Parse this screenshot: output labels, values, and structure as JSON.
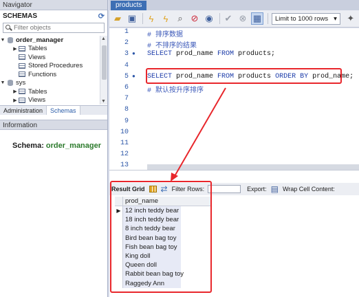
{
  "navigator": {
    "title": "Navigator",
    "schemas_label": "SCHEMAS",
    "filter_placeholder": "Filter objects",
    "tree": [
      {
        "label": "order_manager",
        "level": 0
      },
      {
        "label": "Tables",
        "level": 1
      },
      {
        "label": "Views",
        "level": 1
      },
      {
        "label": "Stored Procedures",
        "level": 1
      },
      {
        "label": "Functions",
        "level": 1
      },
      {
        "label": "sys",
        "level": 0
      },
      {
        "label": "Tables",
        "level": 1
      },
      {
        "label": "Views",
        "level": 1
      }
    ],
    "tabs": [
      "Administration",
      "Schemas"
    ],
    "active_tab": "Schemas"
  },
  "information": {
    "title": "Information",
    "schema_label": "Schema:",
    "schema_value": "order_manager"
  },
  "editor": {
    "tab_title": "products",
    "limit_label": "Limit to 1000 rows",
    "line_numbers": [
      "1",
      "2",
      "3",
      "4",
      "5",
      "6",
      "7",
      "8",
      "9",
      "10",
      "11",
      "12",
      "13"
    ],
    "lines": {
      "l1": "# 排序数据",
      "l2": "# 不排序的结果",
      "l3_kw1": "SELECT",
      "l3_id1": " prod_name ",
      "l3_kw2": "FROM",
      "l3_id2": " products;",
      "l5_kw1": "SELECT",
      "l5_id1": " prod_name ",
      "l5_kw2": "FROM",
      "l5_id2": " products ",
      "l5_kw3": "ORDER BY",
      "l5_id3": " prod_name;",
      "l6": "# 默认按升序排序"
    }
  },
  "result": {
    "result_grid_label": "Result Grid",
    "filter_rows_label": "Filter Rows:",
    "export_label": "Export:",
    "wrap_label": "Wrap Cell Content:",
    "column": "prod_name",
    "rows": [
      "12 inch teddy bear",
      "18 inch teddy bear",
      "8 inch teddy bear",
      "Bird bean bag toy",
      "Fish bean bag toy",
      "King doll",
      "Queen doll",
      "Rabbit bean bag toy",
      "Raggedy Ann"
    ]
  },
  "colors": {
    "annotation_red": "#e8262b",
    "tab_blue": "#3d6fb4"
  }
}
